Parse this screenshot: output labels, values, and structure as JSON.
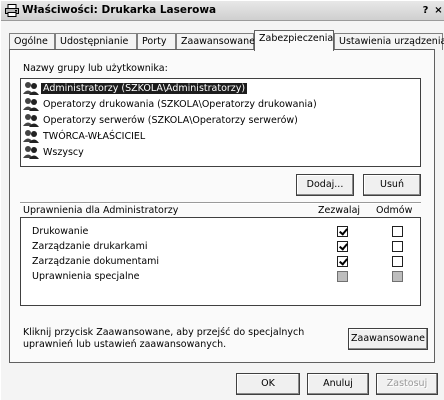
{
  "window": {
    "title": "Właściwości: Drukarka Laserowa",
    "help_btn": "?",
    "close_btn": "×"
  },
  "tabs": [
    {
      "label": "Ogólne",
      "active": false
    },
    {
      "label": "Udostępnianie",
      "active": false
    },
    {
      "label": "Porty",
      "active": false
    },
    {
      "label": "Zaawansowane",
      "active": false
    },
    {
      "label": "Zabezpieczenia",
      "active": true
    },
    {
      "label": "Ustawienia urządzenia",
      "active": false
    }
  ],
  "users": {
    "label": "Nazwy grupy lub użytkownika:",
    "items": [
      {
        "name": "Administratorzy (SZKOLA\\Administratorzy)",
        "selected": true,
        "icon": "group-icon"
      },
      {
        "name": "Operatorzy drukowania (SZKOLA\\Operatorzy drukowania)",
        "selected": false,
        "icon": "group-icon"
      },
      {
        "name": "Operatorzy serwerów (SZKOLA\\Operatorzy serwerów)",
        "selected": false,
        "icon": "group-icon"
      },
      {
        "name": "TWÓRCA-WŁAŚCICIEL",
        "selected": false,
        "icon": "group-icon"
      },
      {
        "name": "Wszyscy",
        "selected": false,
        "icon": "group-icon"
      }
    ],
    "add_button": "Dodaj...",
    "remove_button": "Usuń"
  },
  "permissions": {
    "header": "Uprawnienia dla Administratorzy",
    "allow_col": "Zezwalaj",
    "deny_col": "Odmów",
    "rows": [
      {
        "name": "Drukowanie",
        "allow": true,
        "deny": false,
        "disabled": false
      },
      {
        "name": "Zarządzanie drukarkami",
        "allow": true,
        "deny": false,
        "disabled": false
      },
      {
        "name": "Zarządzanie dokumentami",
        "allow": true,
        "deny": false,
        "disabled": false
      },
      {
        "name": "Uprawnienia specjalne",
        "allow": false,
        "deny": false,
        "disabled": true
      }
    ]
  },
  "advanced": {
    "hint_line1": "Kliknij przycisk Zaawansowane, aby przejść do specjalnych",
    "hint_line2": "uprawnień lub ustawień zaawansowanych.",
    "button": "Zaawansowane"
  },
  "footer": {
    "ok": "OK",
    "cancel": "Anuluj",
    "apply": "Zastosuj"
  }
}
